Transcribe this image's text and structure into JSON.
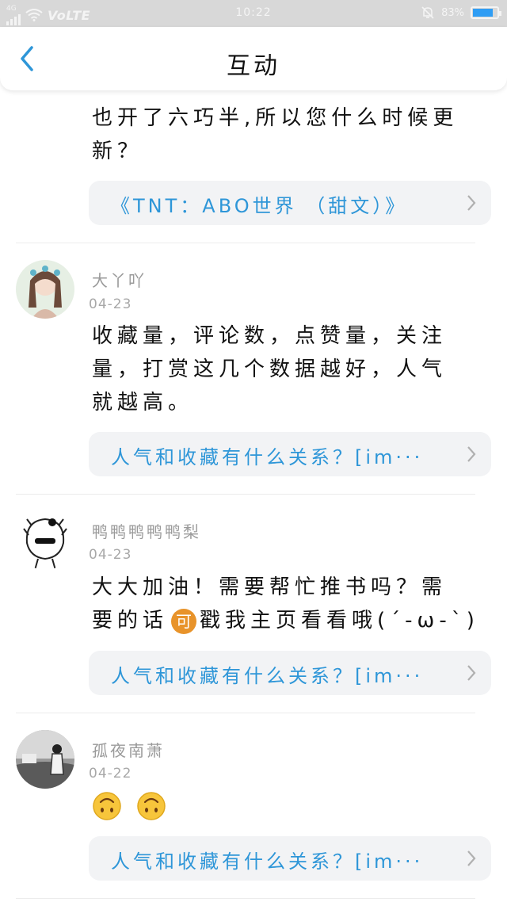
{
  "status_bar": {
    "network": "4G",
    "volte": "VoLTE",
    "time": "10:22",
    "battery": "83%",
    "battery_level": 0.83
  },
  "header": {
    "title": "互动"
  },
  "comments": [
    {
      "text_lines": [
        "也开了六巧半,所以您什么时候更",
        "新？"
      ],
      "book_link": "《TNT：ABO世界 （甜文）》"
    },
    {
      "username": "大丫吖",
      "date": "04-23",
      "text_lines": [
        "收藏量，评论数，点赞量，关注",
        "量，打赏这几个数据越好，人气",
        "就越高。"
      ],
      "book_link": "人气和收藏有什么关系？[im···"
    },
    {
      "username": "鸭鸭鸭鸭鸭梨",
      "date": "04-23",
      "text_line1": "大大加油！需要帮忙推书吗？需",
      "text_line2_a": "要的话",
      "emoji": "可",
      "text_line2_b": "戳我主页看看哦(´-ω-`)",
      "book_link": "人气和收藏有什么关系？[im···"
    },
    {
      "username": "孤夜南萧",
      "date": "04-22",
      "book_link": "人气和收藏有什么关系？[im···"
    }
  ]
}
